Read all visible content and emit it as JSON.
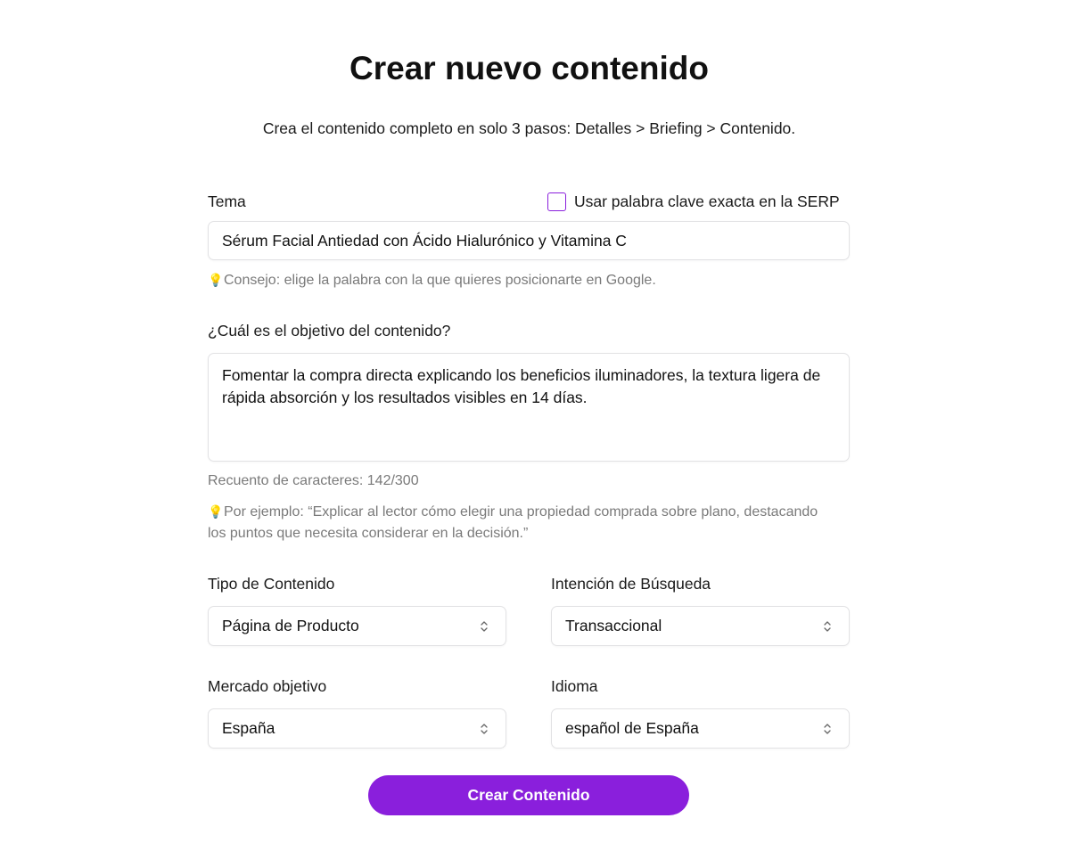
{
  "header": {
    "title": "Crear nuevo contenido",
    "subtitle": "Crea el contenido completo en solo 3 pasos: Detalles > Briefing > Contenido."
  },
  "tema": {
    "label": "Tema",
    "checkbox_label": "Usar palabra clave exacta en la SERP",
    "checkbox_checked": false,
    "value": "Sérum Facial Antiedad con Ácido Hialurónico y Vitamina C",
    "hint": "Consejo: elige la palabra con la que quieres posicionarte en Google."
  },
  "objetivo": {
    "label": "¿Cuál es el objetivo del contenido?",
    "value": "Fomentar la compra directa explicando los beneficios iluminadores, la textura ligera de rápida absorción y los resultados visibles en 14 días.",
    "char_count": "Recuento de caracteres: 142/300",
    "example": "Por ejemplo: “Explicar al lector cómo elegir una propiedad comprada sobre plano, destacando los puntos que necesita considerar en la decisión.”"
  },
  "tipo_contenido": {
    "label": "Tipo de Contenido",
    "selected": "Página de Producto"
  },
  "intencion": {
    "label": "Intención de Búsqueda",
    "selected": "Transaccional"
  },
  "mercado": {
    "label": "Mercado objetivo",
    "selected": "España"
  },
  "idioma": {
    "label": "Idioma",
    "selected": "español de España"
  },
  "actions": {
    "submit_label": "Crear Contenido"
  },
  "icons": {
    "tip": "lightbulb-icon",
    "select": "chevron-up-down-icon"
  },
  "colors": {
    "accent": "#8a1fdc",
    "hint_text": "#7a7a7a",
    "border": "#e2e2e4"
  }
}
